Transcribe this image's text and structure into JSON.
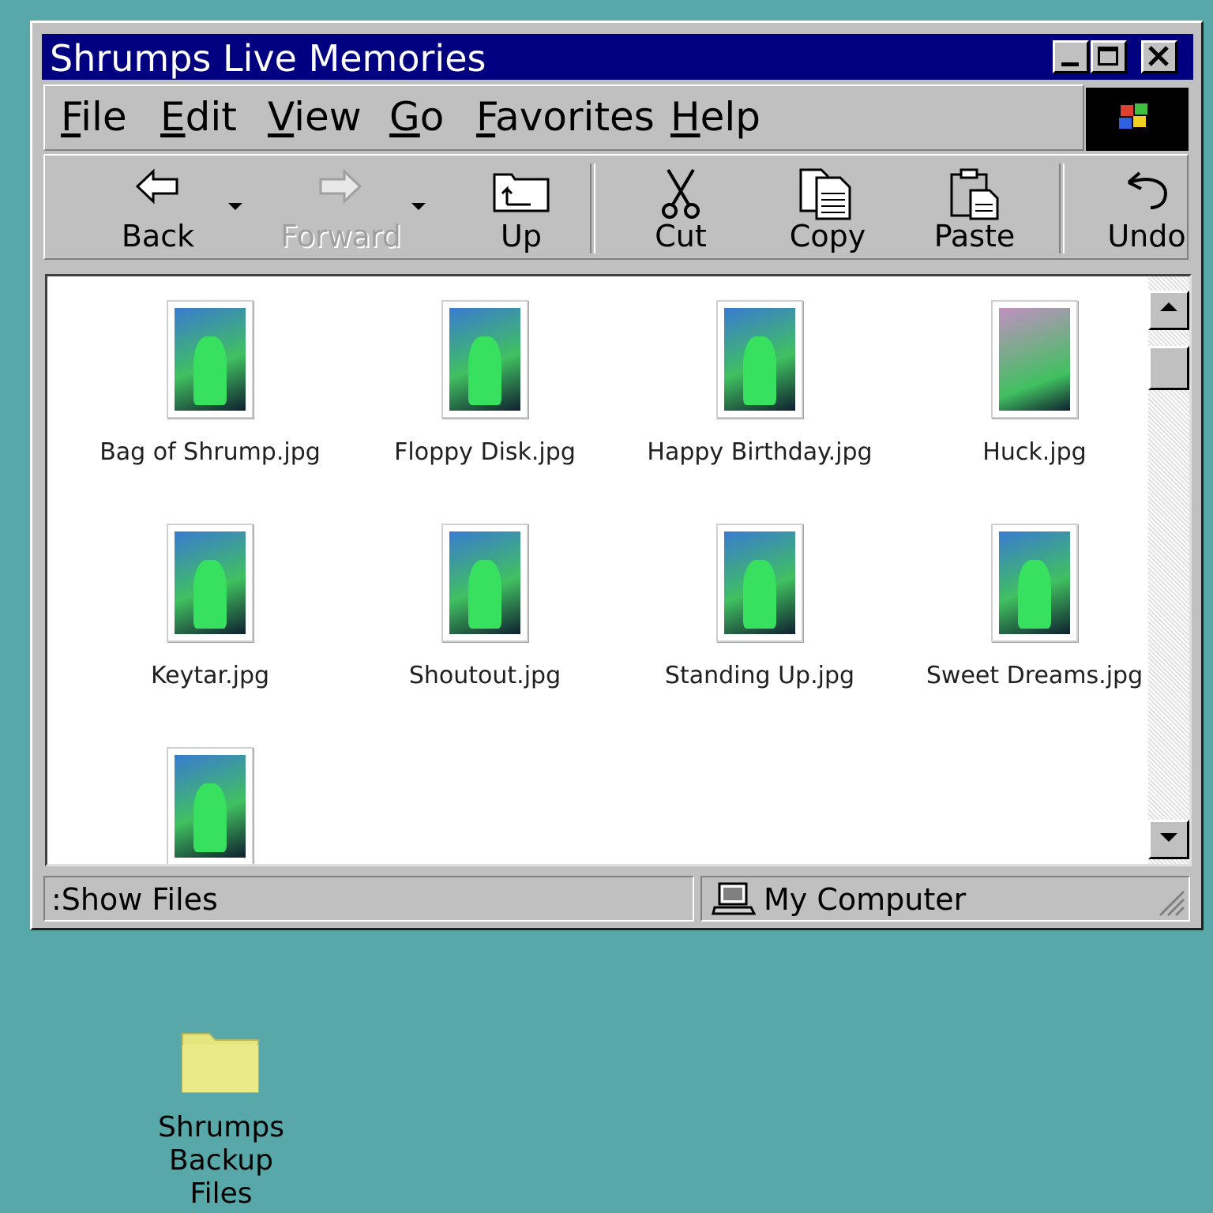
{
  "window": {
    "title": "Shrumps Live Memories",
    "menu": [
      {
        "label": "File",
        "key": "F",
        "rest": "ile"
      },
      {
        "label": "Edit",
        "key": "E",
        "rest": "dit"
      },
      {
        "label": "View",
        "key": "V",
        "rest": "iew"
      },
      {
        "label": "Go",
        "key": "G",
        "rest": "o"
      },
      {
        "label": "Favorites",
        "key": "F",
        "rest": "avorites"
      },
      {
        "label": "Help",
        "key": "H",
        "rest": "elp"
      }
    ],
    "toolbar": {
      "back": "Back",
      "forward": "Forward",
      "up": "Up",
      "cut": "Cut",
      "copy": "Copy",
      "paste": "Paste",
      "undo": "Undo"
    },
    "files": [
      {
        "name": "Bag of Shrump.jpg"
      },
      {
        "name": "Floppy Disk.jpg"
      },
      {
        "name": "Happy Birthday.jpg"
      },
      {
        "name": "Huck.jpg"
      },
      {
        "name": "Keytar.jpg"
      },
      {
        "name": "Shoutout.jpg"
      },
      {
        "name": "Standing Up.jpg"
      },
      {
        "name": "Sweet Dreams.jpg"
      },
      {
        "name": ""
      }
    ],
    "status": {
      "left": ":Show Files",
      "right": "My Computer"
    }
  },
  "desktop": {
    "folder_line1": "Shrumps",
    "folder_line2": "Backup Files"
  },
  "icons": {
    "back": "back-arrow-icon",
    "forward": "forward-arrow-icon",
    "up": "up-folder-icon",
    "cut": "scissors-icon",
    "copy": "copy-icon",
    "paste": "clipboard-icon",
    "undo": "undo-icon",
    "computer": "computer-icon",
    "folder": "folder-icon"
  },
  "colors": {
    "desktop": "#58a8aa",
    "titlebar": "#000080",
    "chrome": "#c0c0c0",
    "folder": "#e6e680"
  }
}
